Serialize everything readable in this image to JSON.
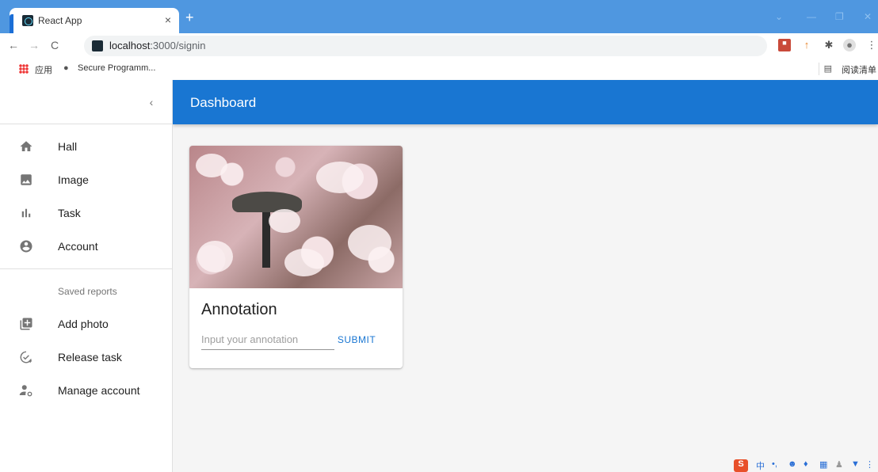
{
  "browser": {
    "tab_title": "React App",
    "tab_close": "×",
    "new_tab": "+",
    "url_host": "localhost",
    "url_rest": ":3000/signin",
    "bookmarks": {
      "apps_label": "应用",
      "secure": "Secure Programm...",
      "reading_list": "阅读清单"
    }
  },
  "drawer": {
    "collapse": "‹",
    "items": [
      {
        "label": "Hall",
        "icon": "home-icon"
      },
      {
        "label": "Image",
        "icon": "image-icon"
      },
      {
        "label": "Task",
        "icon": "bar-chart-icon"
      },
      {
        "label": "Account",
        "icon": "account-circle-icon"
      }
    ],
    "subheader": "Saved reports",
    "secondary_items": [
      {
        "label": "Add photo",
        "icon": "add-photo-icon"
      },
      {
        "label": "Release task",
        "icon": "release-task-icon"
      },
      {
        "label": "Manage account",
        "icon": "manage-account-icon"
      }
    ]
  },
  "appbar": {
    "title": "Dashboard"
  },
  "card": {
    "title": "Annotation",
    "input_placeholder": "Input your annotation",
    "input_value": "",
    "submit_label": "SUBMIT"
  },
  "colors": {
    "primary": "#1976d2",
    "tabstrip": "#4f97e0"
  }
}
